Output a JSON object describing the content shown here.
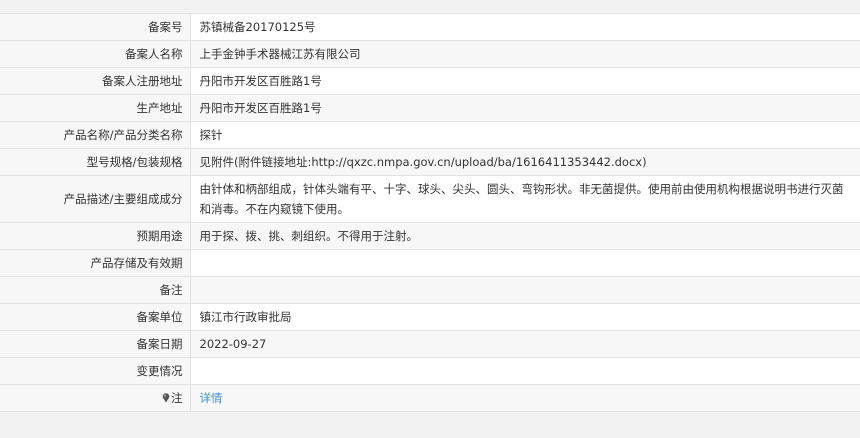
{
  "record": {
    "filing_number": {
      "label": "备案号",
      "value": "苏镇械备20170125号"
    },
    "filer_name": {
      "label": "备案人名称",
      "value": "上手金钟手术器械江苏有限公司"
    },
    "registered_address": {
      "label": "备案人注册地址",
      "value": "丹阳市开发区百胜路1号"
    },
    "production_address": {
      "label": "生产地址",
      "value": "丹阳市开发区百胜路1号"
    },
    "product_name": {
      "label": "产品名称/产品分类名称",
      "value": "探针"
    },
    "model_spec": {
      "label": "型号规格/包装规格",
      "value": "见附件(附件链接地址:http://qxzc.nmpa.gov.cn/upload/ba/1616411353442.docx)"
    },
    "description": {
      "label": "产品描述/主要组成成分",
      "value": "由针体和柄部组成，针体头端有平、十字、球头、尖头、圆头、弯钩形状。非无菌提供。使用前由使用机构根据说明书进行灭菌和消毒。不在内窥镜下使用。"
    },
    "intended_use": {
      "label": "预期用途",
      "value": "用于探、拨、挑、刺组织。不得用于注射。"
    },
    "storage_validity": {
      "label": "产品存储及有效期",
      "value": ""
    },
    "remarks": {
      "label": "备注",
      "value": ""
    },
    "filing_unit": {
      "label": "备案单位",
      "value": "镇江市行政审批局"
    },
    "filing_date": {
      "label": "备案日期",
      "value": "2022-09-27"
    },
    "change_status": {
      "label": "变更情况",
      "value": ""
    },
    "note": {
      "label": "注",
      "link": "详情",
      "icon": "pin-icon"
    }
  }
}
